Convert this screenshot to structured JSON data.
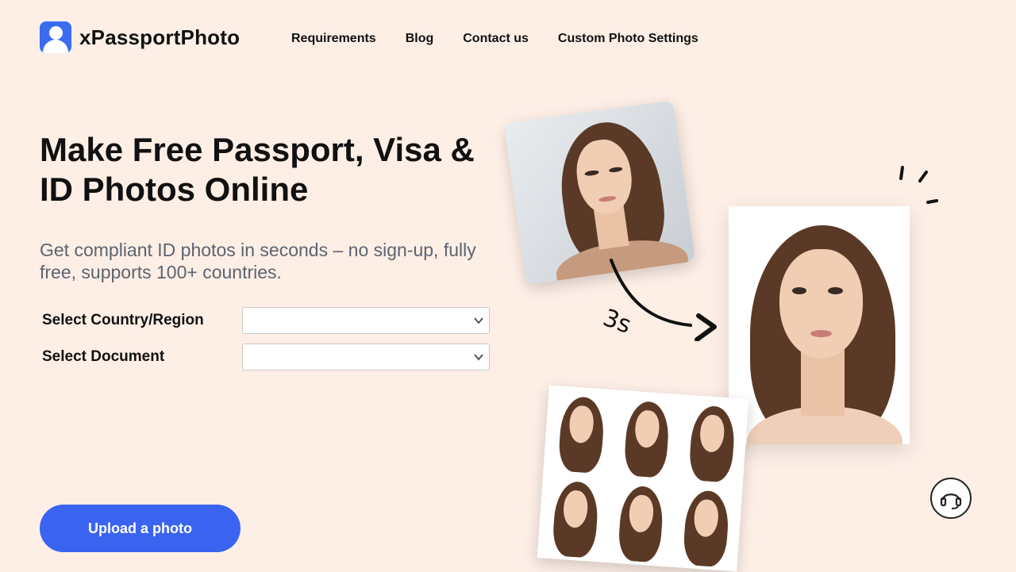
{
  "brand": {
    "name": "xPassportPhoto"
  },
  "nav": {
    "items": [
      {
        "label": "Requirements"
      },
      {
        "label": "Blog"
      },
      {
        "label": "Contact us"
      },
      {
        "label": "Custom Photo Settings"
      }
    ]
  },
  "hero": {
    "title": "Make Free Passport, Visa & ID Photos Online",
    "subtitle": "Get compliant ID photos in seconds – no sign-up, fully free, supports 100+ countries."
  },
  "form": {
    "country_label": "Select Country/Region",
    "country_value": "",
    "document_label": "Select Document",
    "document_value": ""
  },
  "cta": {
    "upload_label": "Upload a photo"
  },
  "illustration": {
    "timer_text": "3s"
  },
  "colors": {
    "background": "#fdefe6",
    "accent": "#3a64f0"
  },
  "icons": {
    "logo": "person-badge-icon",
    "support": "headset-icon",
    "dropdown": "chevron-down-icon"
  }
}
